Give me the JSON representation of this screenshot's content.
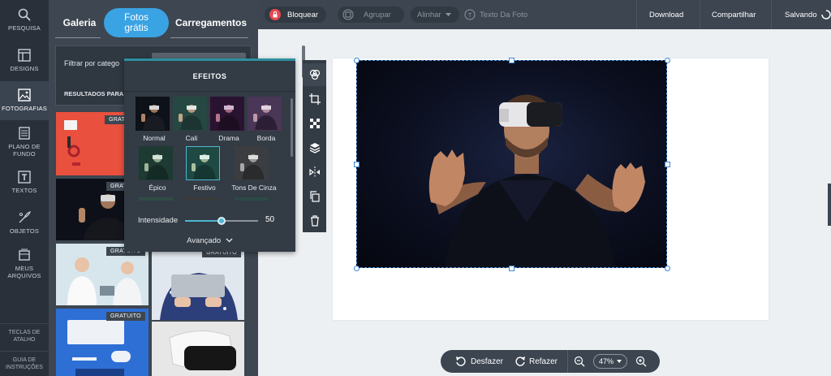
{
  "rail": {
    "items": [
      {
        "label": "PESQUISA",
        "icon": "search-icon"
      },
      {
        "label": "DESIGNS",
        "icon": "layout-icon"
      },
      {
        "label": "FOTOGRAFIAS",
        "icon": "image-icon"
      },
      {
        "label": "PLANO DE\nFUNDO",
        "icon": "background-icon"
      },
      {
        "label": "TEXTOS",
        "icon": "text-icon"
      },
      {
        "label": "OBJETOS",
        "icon": "shapes-icon"
      },
      {
        "label": "MEUS\nARQUIVOS",
        "icon": "folder-icon"
      }
    ],
    "shortcuts": "TECLAS DE\nATALHO",
    "guide": "GUIA DE\nINSTRUÇÕES"
  },
  "panel": {
    "tabs": [
      "Galeria",
      "Fotos\ngrátis",
      "Carregamentos"
    ],
    "active_tab": 1,
    "filter_label": "Filtrar por catego",
    "results_label": "RESULTADOS PARA",
    "badge": "GRATUITO",
    "badge_partial": "GRATUITO",
    "badge_partial2": "GRATUITO",
    "badge_partial3": "GRATUITO",
    "badge_partial4": "GRATUITO"
  },
  "effects": {
    "title": "EFEITOS",
    "filters": [
      "Normal",
      "Cali",
      "Drama",
      "Borda",
      "Épico",
      "Festivo",
      "Tons De Cinza"
    ],
    "selected": "Festivo",
    "intensity_label": "Intensidade",
    "intensity_value": "50",
    "intensity_fraction": 0.5,
    "advanced": "Avançado"
  },
  "toolbar": {
    "lock": "Bloquear",
    "group": "Agrupar",
    "align": "Alinhar",
    "text": "Texto Da Foto",
    "download": "Download",
    "share": "Compartilhar",
    "saving": "Salvando"
  },
  "bottom": {
    "undo": "Desfazer",
    "redo": "Refazer",
    "zoom": "47%"
  },
  "colors": {
    "accent": "#3aa3e3",
    "rail": "#293039",
    "panel": "#3d4651",
    "lock": "#e8484f"
  }
}
